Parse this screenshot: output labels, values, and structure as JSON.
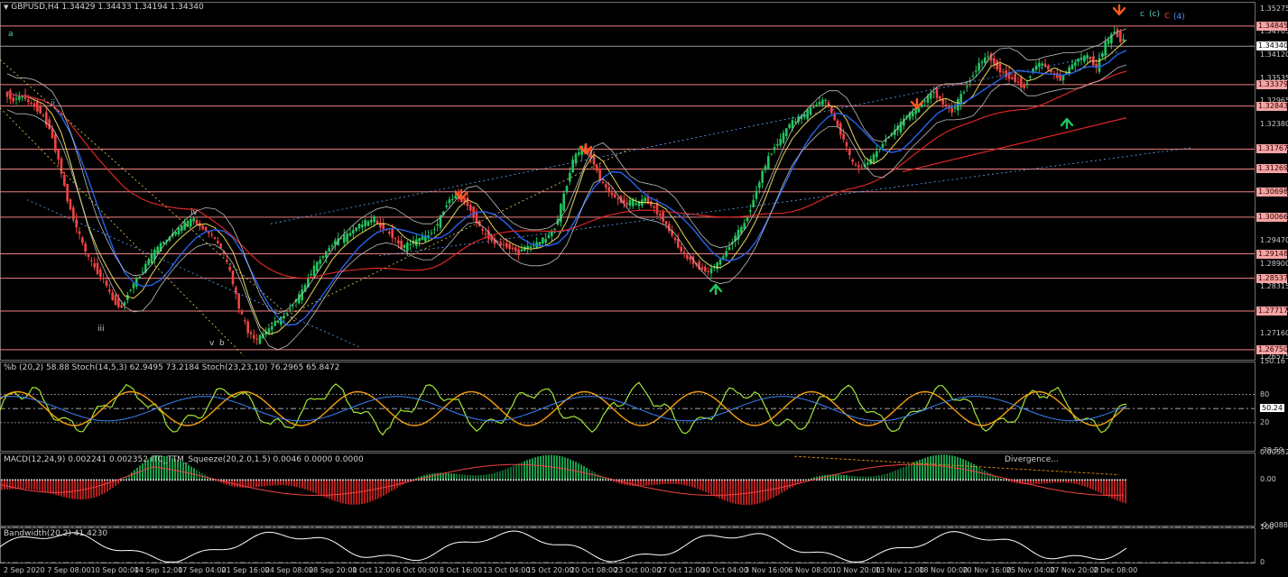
{
  "header": {
    "symbol": "GBPUSD,H4",
    "ohlc": "1.34429 1.34433 1.34194 1.34340"
  },
  "wave_labels": [
    {
      "id": "a",
      "text": "a",
      "color": "#4fd1c5"
    },
    {
      "id": "ii",
      "text": "ii",
      "color": "#4fd1c5"
    },
    {
      "id": "iii",
      "text": "iii",
      "color": "#c8c8c8"
    },
    {
      "id": "iv",
      "text": "iv",
      "color": "#c8c8c8"
    },
    {
      "id": "v",
      "text": "v",
      "color": "#c8c8c8"
    },
    {
      "id": "b",
      "text": "b",
      "color": "#c8c8c8"
    },
    {
      "id": "c1",
      "text": "c",
      "color": "#4fd1c5"
    },
    {
      "id": "c2",
      "text": "(c)",
      "color": "#4fd1c5"
    },
    {
      "id": "c3",
      "text": "c",
      "color": "#ff3030"
    },
    {
      "id": "c4",
      "text": "(4)",
      "color": "#4f8fff"
    }
  ],
  "chart_data": [
    {
      "type": "line",
      "pane": "price",
      "title": "GBPUSD,H4",
      "ylim": [
        1.265,
        1.3545
      ],
      "y_ticks": [
        "1.35275",
        "1.34705",
        "1.34120",
        "1.33535",
        "1.32965",
        "1.32380",
        "1.31795",
        "1.31210",
        "1.30625",
        "1.30040",
        "1.29470",
        "1.28900",
        "1.28315",
        "1.27730",
        "1.27160",
        "1.26575"
      ],
      "horizontal_levels": [
        "1.34845",
        "1.33379",
        "1.32843",
        "1.31767",
        "1.31269",
        "1.30698",
        "1.30066",
        "1.29148",
        "1.28537",
        "1.27717",
        "1.26750"
      ],
      "current_price": "1.34340",
      "x_ticks": [
        "2 Sep 2020",
        "7 Sep 08:00",
        "10 Sep 00:00",
        "14 Sep 12:00",
        "17 Sep 04:00",
        "21 Sep 16:00",
        "24 Sep 08:00",
        "28 Sep 20:00",
        "1 Oct 12:00",
        "6 Oct 00:00",
        "8 Oct 16:00",
        "13 Oct 04:00",
        "15 Oct 20:00",
        "20 Oct 08:00",
        "23 Oct 00:00",
        "27 Oct 12:00",
        "30 Oct 04:00",
        "3 Nov 16:00",
        "6 Nov 08:00",
        "10 Nov 20:00",
        "13 Nov 12:00",
        "18 Nov 00:00",
        "20 Nov 16:00",
        "25 Nov 04:00",
        "27 Nov 20:00",
        "2 Dec 08:00"
      ],
      "series": [
        {
          "name": "close",
          "color": "#22c55e",
          "x": [
            0,
            10,
            20,
            30,
            40,
            50,
            60,
            70,
            80,
            90,
            100,
            110,
            120,
            130,
            140,
            150,
            160,
            170,
            180,
            190,
            200,
            210,
            220,
            230,
            240,
            250,
            260,
            270,
            280,
            290,
            300,
            310,
            320,
            330,
            340,
            350,
            360,
            370,
            380,
            390,
            400,
            410,
            420,
            430,
            440,
            450,
            460,
            470,
            480,
            490,
            500,
            510,
            520,
            530,
            540,
            550,
            560,
            570,
            580,
            590,
            600,
            610,
            620,
            630,
            640,
            650,
            660,
            670,
            680,
            690,
            700,
            710,
            720,
            730,
            740,
            750,
            760,
            770,
            780,
            790,
            800,
            810,
            820,
            830,
            840,
            850,
            860,
            870,
            880,
            890,
            900,
            910,
            920,
            930,
            940,
            950,
            960,
            970,
            980,
            990,
            1000,
            1010,
            1020,
            1030,
            1040,
            1050,
            1060,
            1070,
            1080,
            1090,
            1100,
            1110,
            1120,
            1130,
            1140,
            1150,
            1160,
            1170,
            1180,
            1190,
            1200,
            1210,
            1220,
            1230,
            1240
          ],
          "y": [
            1.332,
            1.33,
            1.331,
            1.329,
            1.327,
            1.323,
            1.315,
            1.305,
            1.298,
            1.292,
            1.288,
            1.285,
            1.28,
            1.278,
            1.283,
            1.286,
            1.29,
            1.293,
            1.295,
            1.297,
            1.299,
            1.3,
            1.298,
            1.296,
            1.293,
            1.287,
            1.278,
            1.272,
            1.27,
            1.272,
            1.274,
            1.276,
            1.279,
            1.282,
            1.287,
            1.29,
            1.293,
            1.295,
            1.296,
            1.298,
            1.299,
            1.3,
            1.298,
            1.296,
            1.293,
            1.294,
            1.295,
            1.296,
            1.299,
            1.304,
            1.306,
            1.305,
            1.301,
            1.297,
            1.295,
            1.294,
            1.293,
            1.292,
            1.293,
            1.294,
            1.295,
            1.298,
            1.306,
            1.315,
            1.318,
            1.316,
            1.31,
            1.307,
            1.305,
            1.304,
            1.304,
            1.305,
            1.303,
            1.3,
            1.296,
            1.292,
            1.29,
            1.288,
            1.287,
            1.289,
            1.292,
            1.296,
            1.299,
            1.305,
            1.312,
            1.317,
            1.32,
            1.324,
            1.325,
            1.327,
            1.329,
            1.33,
            1.325,
            1.32,
            1.314,
            1.313,
            1.315,
            1.318,
            1.321,
            1.323,
            1.326,
            1.327,
            1.33,
            1.332,
            1.329,
            1.327,
            1.331,
            1.335,
            1.339,
            1.341,
            1.338,
            1.336,
            1.335,
            1.333,
            1.338,
            1.339,
            1.337,
            1.335,
            1.338,
            1.34,
            1.341,
            1.338,
            1.344,
            1.347,
            1.344
          ]
        }
      ]
    },
    {
      "type": "line",
      "pane": "oscillator",
      "title": "%b (20,2) 58.88  Stoch(14,5,3) 62.9495 73.2184  Stoch(23,23,10) 76.2965 65.8472",
      "ylim": [
        -39.59,
        150.16
      ],
      "y_ticks": [
        "150.16",
        "80",
        "50.24",
        "20",
        "-39.59"
      ],
      "series": [
        {
          "name": "%b",
          "color": "#a3e635"
        },
        {
          "name": "Stoch slow",
          "color": "#f59e0b"
        },
        {
          "name": "Stoch signal",
          "color": "#3b82f6"
        }
      ]
    },
    {
      "type": "bar",
      "pane": "macd",
      "title": "MACD(12,24,9) 0.002241 0.002352  ITC_TTM_Squeeze(20,2.0,1.5) 0.0046 0.0000 0.0000",
      "annotation": "Divergence...",
      "ylim": [
        -0.008894,
        0.005324
      ],
      "y_ticks": [
        "0.005324",
        "0.00",
        "-0.008894"
      ]
    },
    {
      "type": "line",
      "pane": "bandwidth",
      "title": "Bandwidth(20,2) 41.4230",
      "ylim": [
        0,
        100
      ],
      "y_ticks": [
        "100",
        "0"
      ]
    }
  ]
}
